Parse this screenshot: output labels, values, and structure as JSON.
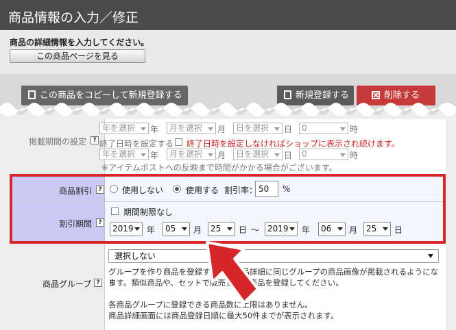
{
  "header": {
    "title": "商品情報の入力／修正"
  },
  "intro": {
    "description": "商品の詳細情報を入力してください。",
    "view_page_label": "この商品ページを見る"
  },
  "toolbar": {
    "copy_label": "この商品をコピーして新規登録する",
    "new_label": "新規登録する",
    "delete_label": "削除する"
  },
  "period": {
    "label": "掲載期間の設定",
    "year_placeholder": "年を選択",
    "month_placeholder": "月を選択",
    "day_placeholder": "日を選択",
    "hour_value": "0",
    "unit_year": "年",
    "unit_month": "月",
    "unit_day": "日",
    "unit_hour": "時",
    "end_label": "終了日時を設定する",
    "end_warning": "終了日時を設定しなければショップに表示され続けます。",
    "note": "※アイテムポストへの反映まで時間がかかる場合がございます。"
  },
  "discount": {
    "label": "商品割引",
    "option_off": "使用しない",
    "option_on": "使用する",
    "rate_label": "割引率：",
    "rate_value": "50",
    "rate_unit": "%"
  },
  "discount_period": {
    "label": "割引期間",
    "unlimited_label": "期間制限なし",
    "start_year": "2019",
    "start_month": "05",
    "start_day": "25",
    "end_year": "2019",
    "end_month": "06",
    "end_day": "25",
    "unit_year": "年",
    "unit_month": "月",
    "unit_day": "日",
    "tilde": "～"
  },
  "group": {
    "label": "商品グループ",
    "selected": "選択しない",
    "line1": "グループを作り商品を登録すると、商品詳細に同じグループの商品画像が掲載されるようになり",
    "line2": "ます。類似商品や、セットで販売したい商品を登録してください。",
    "line3": "各商品グループに登録できる商品数に上限はありません。",
    "line4": "商品詳細画面には商品登録日順に最大50件までが表示されます。"
  },
  "help_mark": "?",
  "colors": {
    "accent_red": "#d6262a",
    "header_bg": "#4b4b4b",
    "label_bg": "#c9c9f4"
  }
}
